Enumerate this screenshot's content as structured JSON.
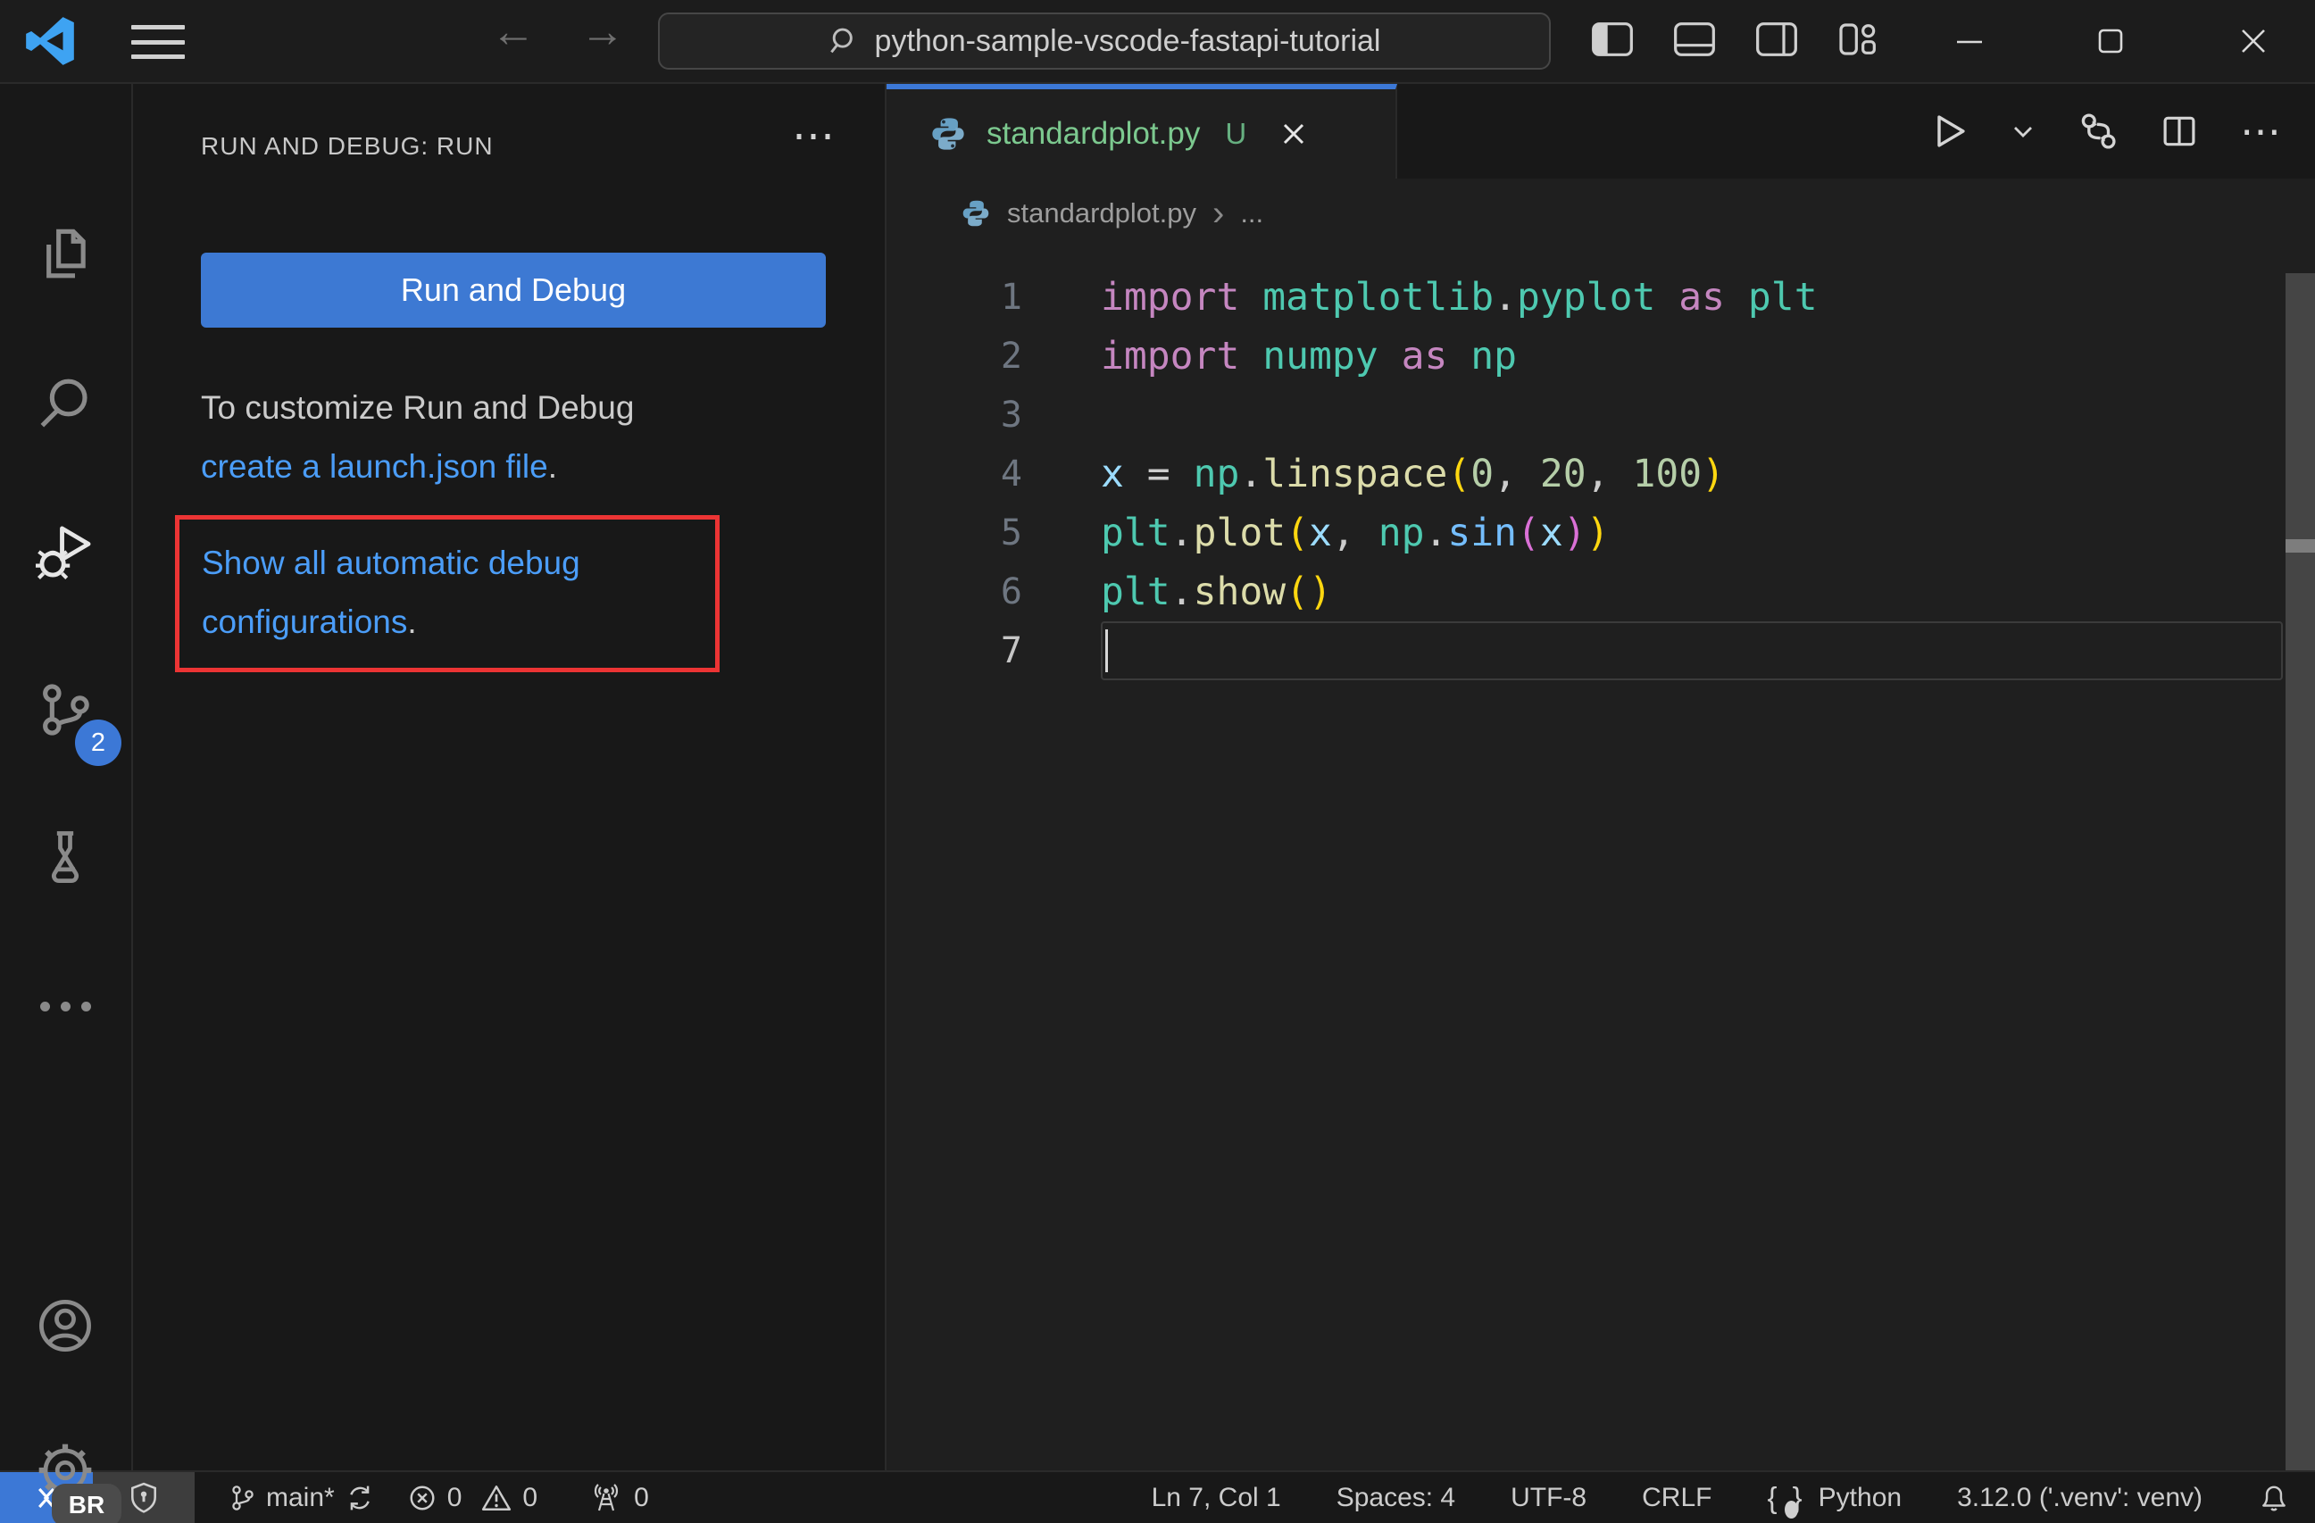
{
  "titlebar": {
    "search_value": "python-sample-vscode-fastapi-tutorial"
  },
  "icons": {
    "back_glyph": "←",
    "forward_glyph": "→",
    "ellipsis": "⋯",
    "breadcrumb_sep": "›",
    "breadcrumb_more": "..."
  },
  "activity_bar": {
    "scm_badge": "2",
    "profile_badge": "BR"
  },
  "sidebar": {
    "header": "RUN AND DEBUG: RUN",
    "run_button": "Run and Debug",
    "customize_line": "To customize Run and Debug",
    "create_link": "create a launch.json file",
    "period": ".",
    "show_all_line1": "Show all automatic debug",
    "show_all_line2": "configurations"
  },
  "editor": {
    "tab": {
      "label": "standardplot.py",
      "modified_badge": "U"
    },
    "breadcrumb": {
      "file": "standardplot.py"
    },
    "code": {
      "language": "python",
      "lines": [
        {
          "n": "1",
          "tokens": [
            {
              "t": "import",
              "c": "kw"
            },
            {
              "t": " ",
              "c": "pln"
            },
            {
              "t": "matplotlib",
              "c": "typ"
            },
            {
              "t": ".",
              "c": "pln"
            },
            {
              "t": "pyplot",
              "c": "typ"
            },
            {
              "t": " ",
              "c": "pln"
            },
            {
              "t": "as",
              "c": "kw"
            },
            {
              "t": " ",
              "c": "pln"
            },
            {
              "t": "plt",
              "c": "typ"
            }
          ]
        },
        {
          "n": "2",
          "tokens": [
            {
              "t": "import",
              "c": "kw"
            },
            {
              "t": " ",
              "c": "pln"
            },
            {
              "t": "numpy",
              "c": "typ"
            },
            {
              "t": " ",
              "c": "pln"
            },
            {
              "t": "as",
              "c": "kw"
            },
            {
              "t": " ",
              "c": "pln"
            },
            {
              "t": "np",
              "c": "typ"
            }
          ]
        },
        {
          "n": "3",
          "tokens": []
        },
        {
          "n": "4",
          "tokens": [
            {
              "t": "x",
              "c": "var"
            },
            {
              "t": " ",
              "c": "pln"
            },
            {
              "t": "=",
              "c": "pln"
            },
            {
              "t": " ",
              "c": "pln"
            },
            {
              "t": "np",
              "c": "typ"
            },
            {
              "t": ".",
              "c": "pln"
            },
            {
              "t": "linspace",
              "c": "fn"
            },
            {
              "t": "(",
              "c": "br1"
            },
            {
              "t": "0",
              "c": "num"
            },
            {
              "t": ", ",
              "c": "pln"
            },
            {
              "t": "20",
              "c": "num"
            },
            {
              "t": ", ",
              "c": "pln"
            },
            {
              "t": "100",
              "c": "num"
            },
            {
              "t": ")",
              "c": "br1"
            }
          ]
        },
        {
          "n": "5",
          "tokens": [
            {
              "t": "plt",
              "c": "typ"
            },
            {
              "t": ".",
              "c": "pln"
            },
            {
              "t": "plot",
              "c": "fn"
            },
            {
              "t": "(",
              "c": "br1"
            },
            {
              "t": "x",
              "c": "var"
            },
            {
              "t": ", ",
              "c": "pln"
            },
            {
              "t": "np",
              "c": "typ"
            },
            {
              "t": ".",
              "c": "pln"
            },
            {
              "t": "sin",
              "c": "fnb"
            },
            {
              "t": "(",
              "c": "br2"
            },
            {
              "t": "x",
              "c": "var"
            },
            {
              "t": ")",
              "c": "br2"
            },
            {
              "t": ")",
              "c": "br1"
            }
          ]
        },
        {
          "n": "6",
          "tokens": [
            {
              "t": "plt",
              "c": "typ"
            },
            {
              "t": ".",
              "c": "pln"
            },
            {
              "t": "show",
              "c": "fn"
            },
            {
              "t": "(",
              "c": "br1"
            },
            {
              "t": ")",
              "c": "br1"
            }
          ]
        },
        {
          "n": "7",
          "tokens": [],
          "active": true
        }
      ]
    }
  },
  "status_bar": {
    "branch": "main*",
    "errors": "0",
    "warnings": "0",
    "ports": "0",
    "cursor_position": "Ln 7, Col 1",
    "indentation": "Spaces: 4",
    "encoding": "UTF-8",
    "eol": "CRLF",
    "language": "Python",
    "interpreter": "3.12.0 ('.venv': venv)"
  },
  "colors": {
    "accent_blue": "#3c78d6",
    "button_blue": "#3d79d3",
    "link_blue": "#4b9df8",
    "annotation_red": "#ec3434",
    "untracked_green": "#73c991"
  }
}
